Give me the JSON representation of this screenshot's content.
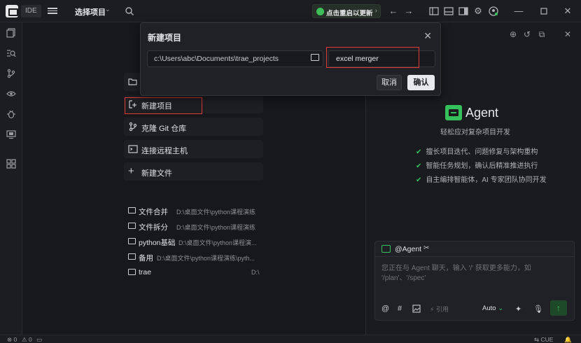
{
  "titlebar": {
    "mode": "IDE",
    "project_selector": "选择项目",
    "update_label": "点击重启以更新"
  },
  "dialog": {
    "title": "新建项目",
    "path_value": "c:\\Users\\abc\\Documents\\trae_projects",
    "name_value": "excel merger",
    "cancel": "取消",
    "confirm": "确认"
  },
  "quick_actions": [
    {
      "label": "新建项目"
    },
    {
      "label": "克隆 Git 仓库"
    },
    {
      "label": "连接远程主机"
    },
    {
      "label": "新建文件"
    }
  ],
  "recent": [
    {
      "name": "文件合并",
      "path": "D:\\桌面文件\\python课程演练"
    },
    {
      "name": "文件拆分",
      "path": "D:\\桌面文件\\python课程演练"
    },
    {
      "name": "python基础",
      "path": "D:\\桌面文件\\python课程演..."
    },
    {
      "name": "备用",
      "path": "D:\\桌面文件\\python课程演练\\pyth..."
    },
    {
      "name": "trae",
      "path": "D:\\"
    }
  ],
  "agent": {
    "title": "Agent",
    "subtitle": "轻松应对复杂项目开发",
    "features": [
      "擅长项目迭代、问题修复与架构重构",
      "智能任务规划，确认后精准推进执行",
      "自主编排智能体，AI 专家团队协同开发"
    ]
  },
  "chat": {
    "mention": "@Agent",
    "placeholder": "您正在与 Agent 聊天，输入 '/' 获取更多能力，如 '/plan'、'/spec'",
    "refs": "引用",
    "model": "Auto"
  },
  "statusbar": {
    "errors": "0",
    "warnings": "0",
    "cue": "CUE"
  },
  "colors": {
    "accent_green": "#34c15b",
    "highlight_red": "#e03a36"
  }
}
